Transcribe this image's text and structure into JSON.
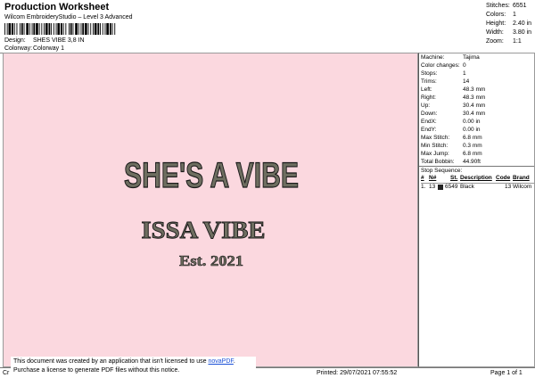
{
  "header": {
    "title": "Production Worksheet",
    "subtitle": "Wilcom EmbroideryStudio – Level 3 Advanced",
    "design_label": "Design:",
    "design_value": "SHES VIBE 3,8 IN",
    "colorway_label": "Colorway:",
    "colorway_value": "Colorway 1"
  },
  "stats": [
    {
      "label": "Stitches:",
      "value": "6551"
    },
    {
      "label": "Colors:",
      "value": "1"
    },
    {
      "label": "Height:",
      "value": "2.40 in"
    },
    {
      "label": "Width:",
      "value": "3.80 in"
    },
    {
      "label": "Zoom:",
      "value": "1:1"
    }
  ],
  "design_text": {
    "line1": "SHE'S A VIBE",
    "line2": "ISSA VIBE",
    "line3": "Est. 2021"
  },
  "colors": {
    "canvas_bg": "#fbd8df",
    "thread_fill": "#6e6e60",
    "thread_outline": "#1a1a1a"
  },
  "machine": [
    {
      "label": "Machine:",
      "value": "Tajima"
    },
    {
      "label": "Color changes:",
      "value": "0"
    },
    {
      "label": "Stops:",
      "value": "1"
    },
    {
      "label": "Trims:",
      "value": "14"
    },
    {
      "label": "Left:",
      "value": "48.3 mm"
    },
    {
      "label": "Right:",
      "value": "48.3 mm"
    },
    {
      "label": "Up:",
      "value": "30.4 mm"
    },
    {
      "label": "Down:",
      "value": "30.4 mm"
    },
    {
      "label": "EndX:",
      "value": "0.00 in"
    },
    {
      "label": "EndY:",
      "value": "0.00 in"
    },
    {
      "label": "Max Stitch:",
      "value": "6.8 mm"
    },
    {
      "label": "Min Stitch:",
      "value": "0.3 mm"
    },
    {
      "label": "Max Jump:",
      "value": "6.8 mm"
    },
    {
      "label": "Total Bobbin:",
      "value": "44.90ft"
    }
  ],
  "stop_sequence": {
    "title": "Stop Sequence:",
    "headers": {
      "n": "#",
      "no": "N#",
      "st": "St.",
      "description": "Description",
      "code": "Code",
      "brand": "Brand"
    },
    "row": {
      "n": "1.",
      "no": "13",
      "st": "6549",
      "description": "Black",
      "code": "13",
      "brand": "Wilcom"
    }
  },
  "footer": {
    "left": "Cr",
    "printed": "Printed: 29/07/2021 07:55:52",
    "page": "Page 1 of 1"
  },
  "banner": {
    "line1_prefix": "This document was created by an application that isn't licensed to use ",
    "link": "novaPDF",
    "line1_suffix": ".",
    "line2": "Purchase a license to generate PDF files without this notice."
  }
}
